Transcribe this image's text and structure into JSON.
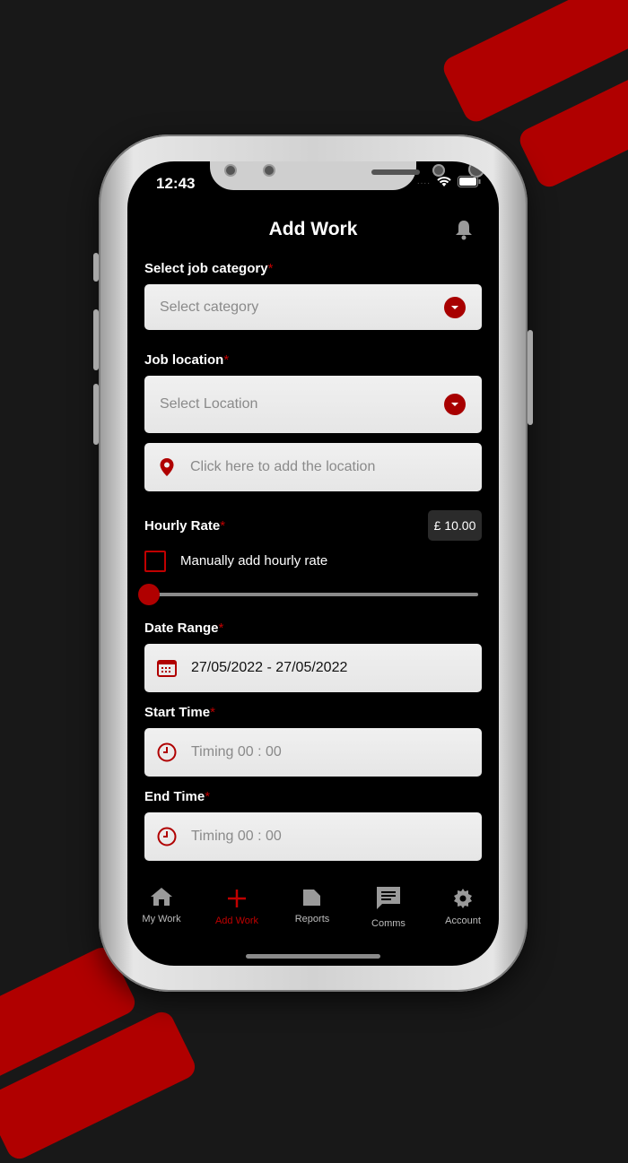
{
  "status": {
    "time": "12:43"
  },
  "header": {
    "title": "Add Work"
  },
  "form": {
    "category": {
      "label": "Select job category",
      "required": "*",
      "placeholder": "Select category"
    },
    "location": {
      "label": "Job location",
      "required": "*",
      "placeholder": "Select Location",
      "add_placeholder": "Click here to add the location"
    },
    "rate": {
      "label": "Hourly Rate",
      "required": "*",
      "value": "£ 10.00",
      "manual_label": "Manually add hourly rate",
      "slider_level": 0
    },
    "date": {
      "label": "Date Range",
      "required": "*",
      "value": "27/05/2022 - 27/05/2022"
    },
    "start": {
      "label": "Start Time",
      "required": "*",
      "placeholder": "Timing 00 : 00"
    },
    "end": {
      "label": "End Time",
      "required": "*",
      "placeholder": "Timing 00 : 00"
    }
  },
  "tabs": [
    {
      "label": "My Work",
      "icon": "home-icon"
    },
    {
      "label": "Add Work",
      "icon": "plus-icon",
      "active": true
    },
    {
      "label": "Reports",
      "icon": "folder-icon"
    },
    {
      "label": "Comms",
      "icon": "chat-icon"
    },
    {
      "label": "Account",
      "icon": "gear-icon"
    }
  ],
  "colors": {
    "accent": "#b00000",
    "background": "#000000",
    "field": "#ececec"
  }
}
